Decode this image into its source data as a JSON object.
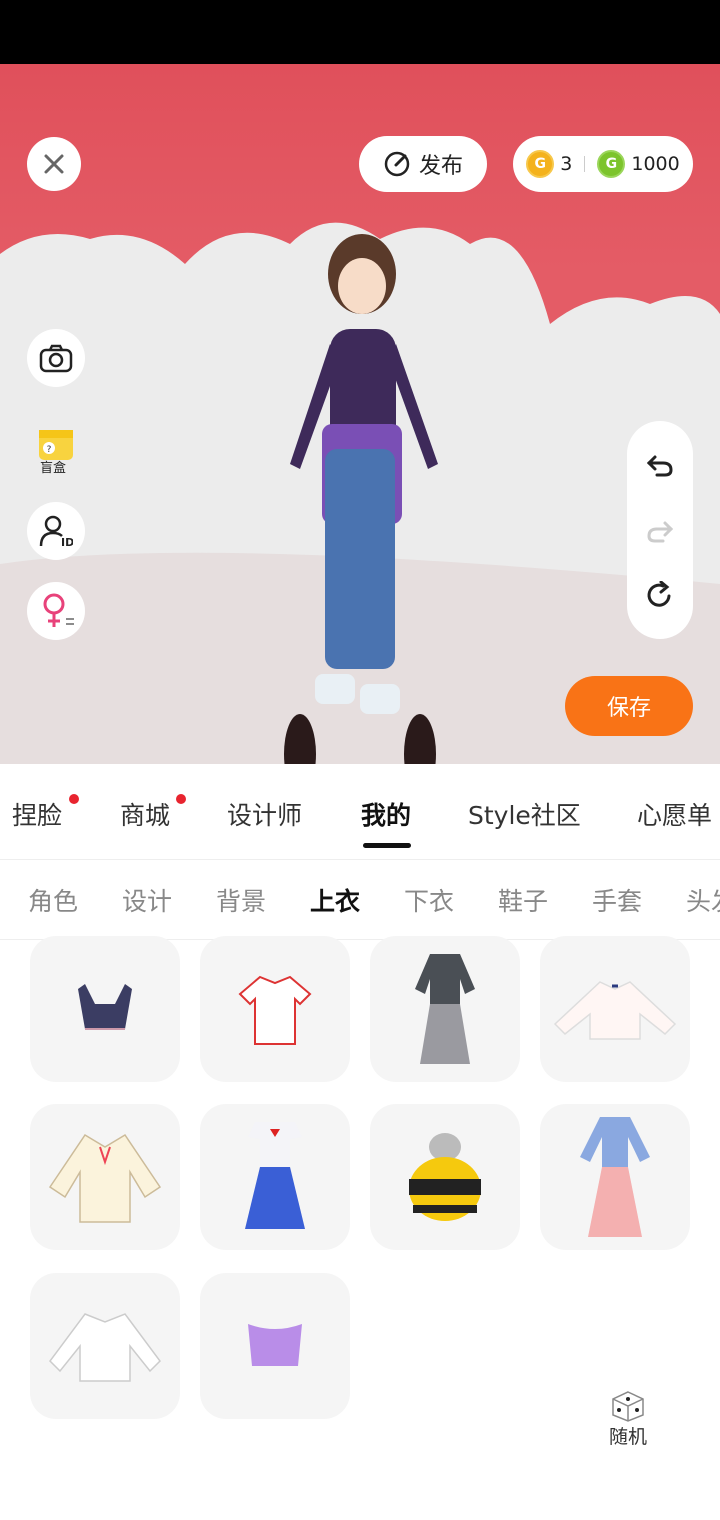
{
  "top": {
    "publish_label": "发布",
    "gold_count": "3",
    "green_count": "1000"
  },
  "side": {
    "blindbox_label": "盲盒"
  },
  "save_label": "保存",
  "tabs": [
    {
      "label": "捏脸",
      "dot": true
    },
    {
      "label": "商城",
      "dot": true
    },
    {
      "label": "设计师",
      "dot": false
    },
    {
      "label": "我的",
      "dot": false,
      "active": true
    },
    {
      "label": "Style社区",
      "dot": false
    },
    {
      "label": "心愿单",
      "dot": false
    }
  ],
  "subtabs": [
    {
      "label": "角色"
    },
    {
      "label": "设计"
    },
    {
      "label": "背景"
    },
    {
      "label": "上衣",
      "active": true
    },
    {
      "label": "下衣"
    },
    {
      "label": "鞋子"
    },
    {
      "label": "手套"
    },
    {
      "label": "头发"
    }
  ],
  "items": [
    {
      "name": "sports-bra"
    },
    {
      "name": "white-tshirt"
    },
    {
      "name": "grey-school-uniform-dress"
    },
    {
      "name": "white-blouse"
    },
    {
      "name": "cream-cardigan"
    },
    {
      "name": "blue-sailor-dress"
    },
    {
      "name": "bee-costume"
    },
    {
      "name": "hanfu-dress"
    },
    {
      "name": "white-shirt"
    },
    {
      "name": "purple-crop-top"
    }
  ],
  "random_label": "随机",
  "colors": {
    "accent": "#f97316",
    "scene_bg": "#e0505b",
    "dot": "#e8242f"
  }
}
